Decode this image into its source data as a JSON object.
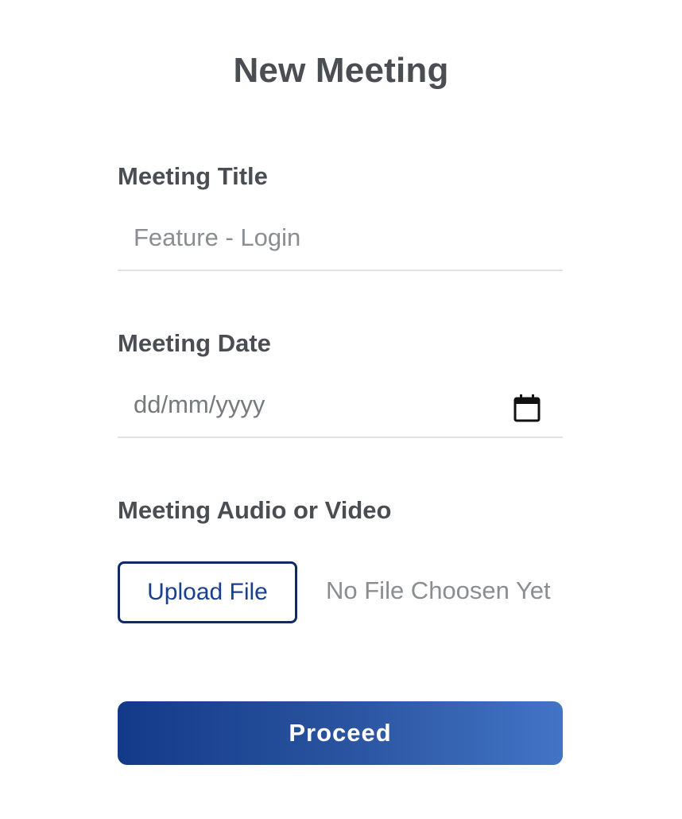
{
  "form": {
    "title": "New Meeting",
    "meeting_title": {
      "label": "Meeting Title",
      "value": "Feature - Login"
    },
    "meeting_date": {
      "label": "Meeting Date",
      "placeholder": "dd/mm/yyyy",
      "icon": "calendar-icon"
    },
    "media": {
      "label": "Meeting Audio or Video",
      "upload_label": "Upload File",
      "status": "No File Choosen Yet"
    },
    "proceed_label": "Proceed"
  },
  "colors": {
    "heading": "#4a4d52",
    "muted_text": "#8a8d91",
    "divider": "#e2e2e2",
    "upload_border": "#0f2a66",
    "upload_text": "#1b3f8f",
    "button_gradient_start": "#123a88",
    "button_gradient_end": "#4274c6"
  }
}
